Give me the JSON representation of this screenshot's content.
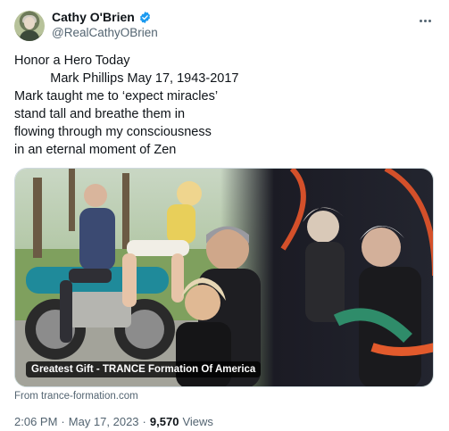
{
  "author": {
    "display_name": "Cathy O'Brien",
    "handle": "@RealCathyOBrien",
    "verified": true,
    "verified_color": "#1d9bf0"
  },
  "body_lines": [
    "Honor a Hero Today",
    "          Mark Phillips May 17, 1943-2017",
    "Mark taught me to ‘expect miracles’",
    "stand tall and breathe them in",
    "flowing through my consciousness",
    "in an eternal moment of Zen"
  ],
  "card": {
    "title": "Greatest Gift - TRANCE Formation Of America",
    "source": "From trance-formation.com"
  },
  "meta": {
    "time": "2:06 PM",
    "separator1": "·",
    "date": "May 17, 2023",
    "separator2": "·",
    "views_count": "9,570",
    "views_label": "Views"
  },
  "icons": {
    "more": "more-icon",
    "verified": "verified-badge-icon"
  }
}
